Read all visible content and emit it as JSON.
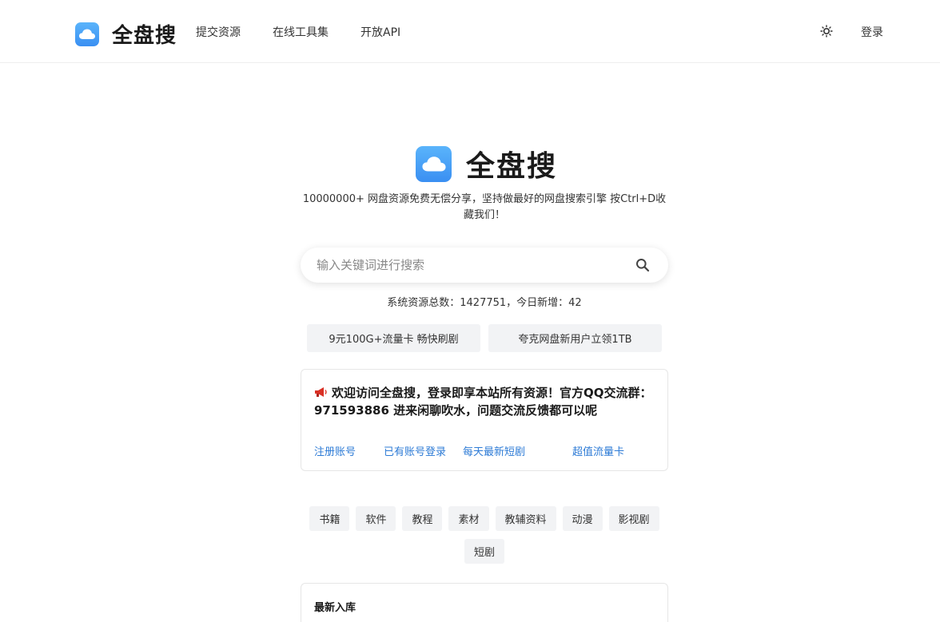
{
  "header": {
    "logo_icon": "cloud-icon",
    "logo_text": "全盘搜",
    "nav": [
      {
        "label": "提交资源"
      },
      {
        "label": "在线工具集"
      },
      {
        "label": "开放API"
      }
    ],
    "theme_icon": "sun-icon",
    "login_label": "登录"
  },
  "hero": {
    "logo_icon": "cloud-icon",
    "title": "全盘搜",
    "tagline": "10000000+ 网盘资源免费无偿分享，坚持做最好的网盘搜索引擎 按Ctrl+D收藏我们！"
  },
  "search": {
    "placeholder": "输入关键词进行搜索",
    "icon": "search-icon"
  },
  "stats": {
    "text": "系统资源总数：1427751，今日新增：42"
  },
  "promos": [
    {
      "label": "9元100G+流量卡 畅快刷剧"
    },
    {
      "label": "夸克网盘新用户立领1TB"
    }
  ],
  "notice": {
    "icon": "megaphone-icon",
    "text": "欢迎访问全盘搜，登录即享本站所有资源！官方QQ交流群：971593886 进来闲聊吹水，问题交流反馈都可以呢",
    "links": [
      {
        "label": "注册账号"
      },
      {
        "label": "已有账号登录"
      },
      {
        "label": "每天最新短剧"
      },
      {
        "label": "超值流量卡"
      }
    ],
    "link_color": "#2d7bd6"
  },
  "categories": [
    {
      "label": "书籍"
    },
    {
      "label": "软件"
    },
    {
      "label": "教程"
    },
    {
      "label": "素材"
    },
    {
      "label": "教辅资料"
    },
    {
      "label": "动漫"
    },
    {
      "label": "影视剧"
    },
    {
      "label": "短剧"
    }
  ],
  "latest": {
    "title": "最新入库"
  },
  "colors": {
    "brand_blue": "#3a8ff2",
    "tag_bg": "#f2f3f5"
  }
}
